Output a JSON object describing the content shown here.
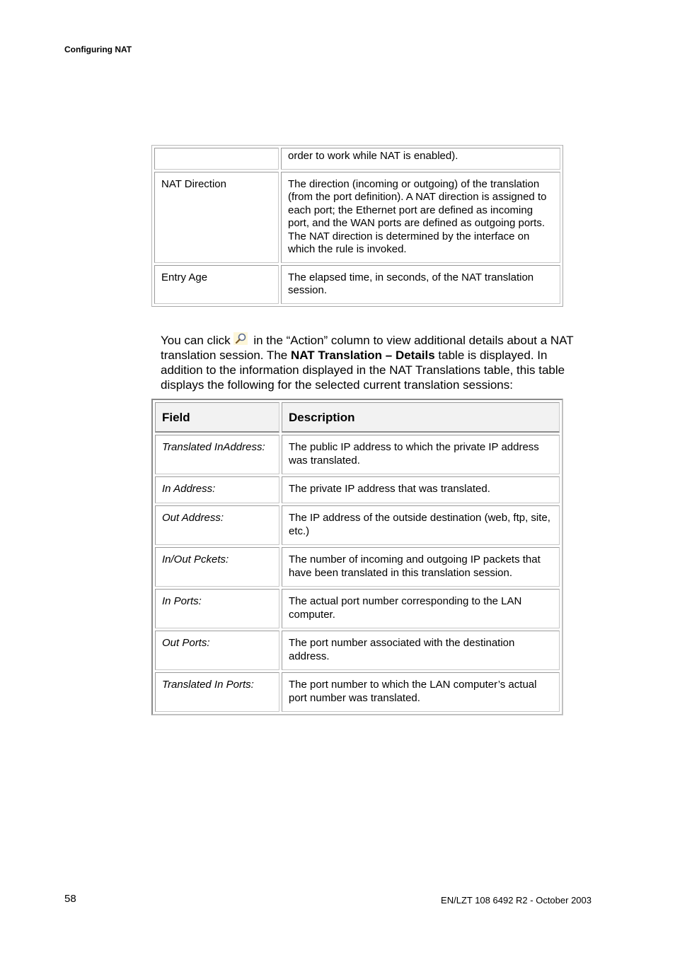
{
  "header": {
    "running_head": "Configuring NAT"
  },
  "table1": {
    "rows": [
      {
        "field": "",
        "description": "order to work while NAT is enabled)."
      },
      {
        "field": "NAT Direction",
        "description": "The direction (incoming or outgoing) of the translation (from the port definition). A NAT direction is assigned to each port; the Ethernet port are defined as incoming port, and the WAN ports are defined as outgoing ports. The NAT direction is determined by the interface on which the rule is invoked."
      },
      {
        "field": "Entry Age",
        "description": "The elapsed time, in seconds, of the NAT translation session."
      }
    ]
  },
  "paragraph": {
    "part1": "You can click",
    "icon": "magnifier-icon",
    "part2": " in the “Action” column to view additional details about a NAT translation session. The ",
    "bold": "NAT Translation – Details",
    "part3": " table is displayed. In addition to the information displayed in the NAT Translations table, this table displays the following for the selected current translation sessions:"
  },
  "table2": {
    "headers": [
      "Field",
      "Description"
    ],
    "rows": [
      {
        "field": "Translated InAddress:",
        "description": "The public IP address to which the private IP address was translated."
      },
      {
        "field": "In Address:",
        "description": "The private IP address that was translated."
      },
      {
        "field": "Out Address:",
        "description": "The IP address of the outside destination (web, ftp, site, etc.)"
      },
      {
        "field": "In/Out Pckets:",
        "description": "The number of incoming and outgoing IP packets that have been translated in this translation session."
      },
      {
        "field": "In Ports:",
        "description": "The actual port number corresponding to the LAN computer."
      },
      {
        "field": "Out Ports:",
        "description": "The port number associated with the destination address."
      },
      {
        "field": "Translated In Ports:",
        "description": "The port number to which the LAN computer’s actual port number was translated."
      }
    ]
  },
  "footer": {
    "page_number": "58",
    "doc_id": "EN/LZT 108 6492 R2  - October 2003"
  },
  "colors": {
    "text": "#000000",
    "header_bg": "#f2f2f2",
    "border": "#9a9a9a",
    "icon_bg": "#fdf6d8"
  }
}
